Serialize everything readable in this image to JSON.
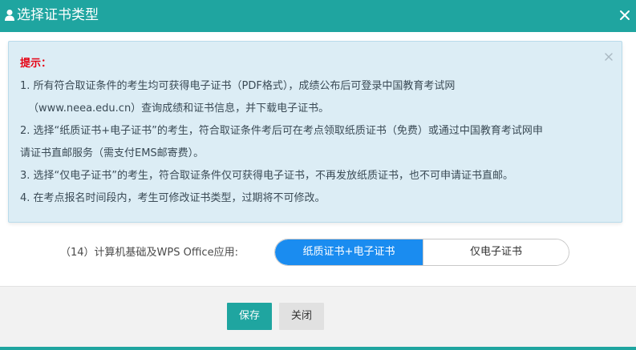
{
  "header": {
    "title": "选择证书类型",
    "icon": "user-icon",
    "close_icon": "close-icon"
  },
  "alert": {
    "title": "提示：",
    "lines": [
      "1. 所有符合取证条件的考生均可获得电子证书（PDF格式），成绩公布后可登录中国教育考试网",
      "（www.neea.edu.cn）查询成绩和证书信息，并下载电子证书。",
      "2. 选择“纸质证书+电子证书”的考生，符合取证条件考后可在考点领取纸质证书（免费）或通过中国教育考试网申",
      "请证书直邮服务（需支付EMS邮寄费）。",
      "3. 选择“仅电子证书”的考生，符合取证条件仅可获得电子证书，不再发放纸质证书，也不可申请证书直邮。",
      "4. 在考点报名时间段内，考生可修改证书类型，过期将不可修改。"
    ],
    "close_icon": "close-icon"
  },
  "form": {
    "label": "（14）计算机基础及WPS Office应用:",
    "options": [
      "纸质证书+电子证书",
      "仅电子证书"
    ],
    "selected": "纸质证书+电子证书"
  },
  "footer": {
    "save_label": "保存",
    "close_label": "关闭"
  },
  "colors": {
    "header": "#1fa5a0",
    "alert_bg": "#dcedf5",
    "alert_title": "#e60012",
    "toggle_active": "#1a8cf0",
    "save_button": "#1fa5a0",
    "close_button": "#e1e1e1"
  }
}
